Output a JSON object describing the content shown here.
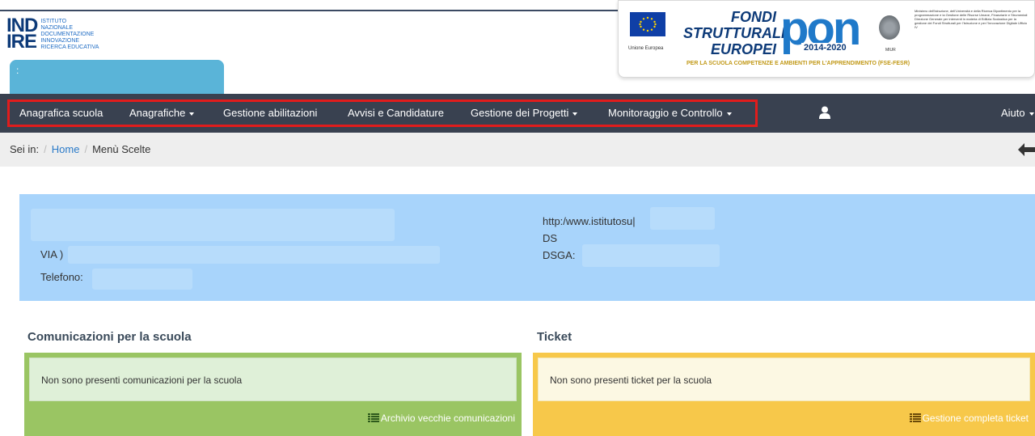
{
  "header": {
    "logo": {
      "big_line1": "IND",
      "big_line2": "IRE",
      "small_lines": [
        "ISTITUTO",
        "NAZIONALE",
        "DOCUMENTAZIONE",
        "INNOVAZIONE",
        "RICERCA EDUCATIVA"
      ]
    },
    "user_tab_text": ":",
    "pon": {
      "eu_label": "Unione Europea",
      "fondi_line1": "FONDI",
      "fondi_line2": "STRUTTURALI",
      "fondi_line3": "EUROPEI",
      "pon_word": "pon",
      "years": "2014-2020",
      "subtitle": "PER LA SCUOLA COMPETENZE E AMBIENTI PER L'APPRENDIMENTO (FSE-FESR)",
      "miur": "MIUR",
      "ministry_text": "Ministero dell'Istruzione, dell'Università e della Ricerca Dipartimento per la programmazione e la Gestione delle Risorse Umane, Finanziarie e Strumentali Direzione Generale per interventi in materia di Edilizia Scolastica per la gestione dei Fondi Strutturali per l'Istruzione e per l'Innovazione Digitale Ufficio IV"
    }
  },
  "nav": {
    "items": [
      {
        "label": "Anagrafica scuola",
        "dropdown": false
      },
      {
        "label": "Anagrafiche",
        "dropdown": true
      },
      {
        "label": "Gestione abilitazioni",
        "dropdown": false
      },
      {
        "label": "Avvisi e Candidature",
        "dropdown": false
      },
      {
        "label": "Gestione dei Progetti",
        "dropdown": true
      },
      {
        "label": "Monitoraggio e Controllo",
        "dropdown": true
      }
    ],
    "aiuto": "Aiuto"
  },
  "breadcrumb": {
    "prefix": "Sei in:",
    "home": "Home",
    "current": "Menù Scelte"
  },
  "school_info": {
    "address": "VIA )",
    "phone_label": "Telefono:",
    "website": "http:/www.istitutosu|",
    "ds_label": "DS",
    "dsga_label": "DSGA:"
  },
  "communications": {
    "title": "Comunicazioni per la scuola",
    "message": "Non sono presenti comunicazioni per la scuola",
    "link": "Archivio vecchie comunicazioni"
  },
  "tickets": {
    "title": "Ticket",
    "message": "Non sono presenti ticket per la scuola",
    "link": "Gestione completa ticket"
  },
  "colors": {
    "navbar": "#394150",
    "highlight_border": "#e11c1c",
    "info_panel": "#a8d4fb",
    "green_panel": "#9ac563",
    "yellow_panel": "#f7c84a",
    "link": "#2a7ac8"
  }
}
